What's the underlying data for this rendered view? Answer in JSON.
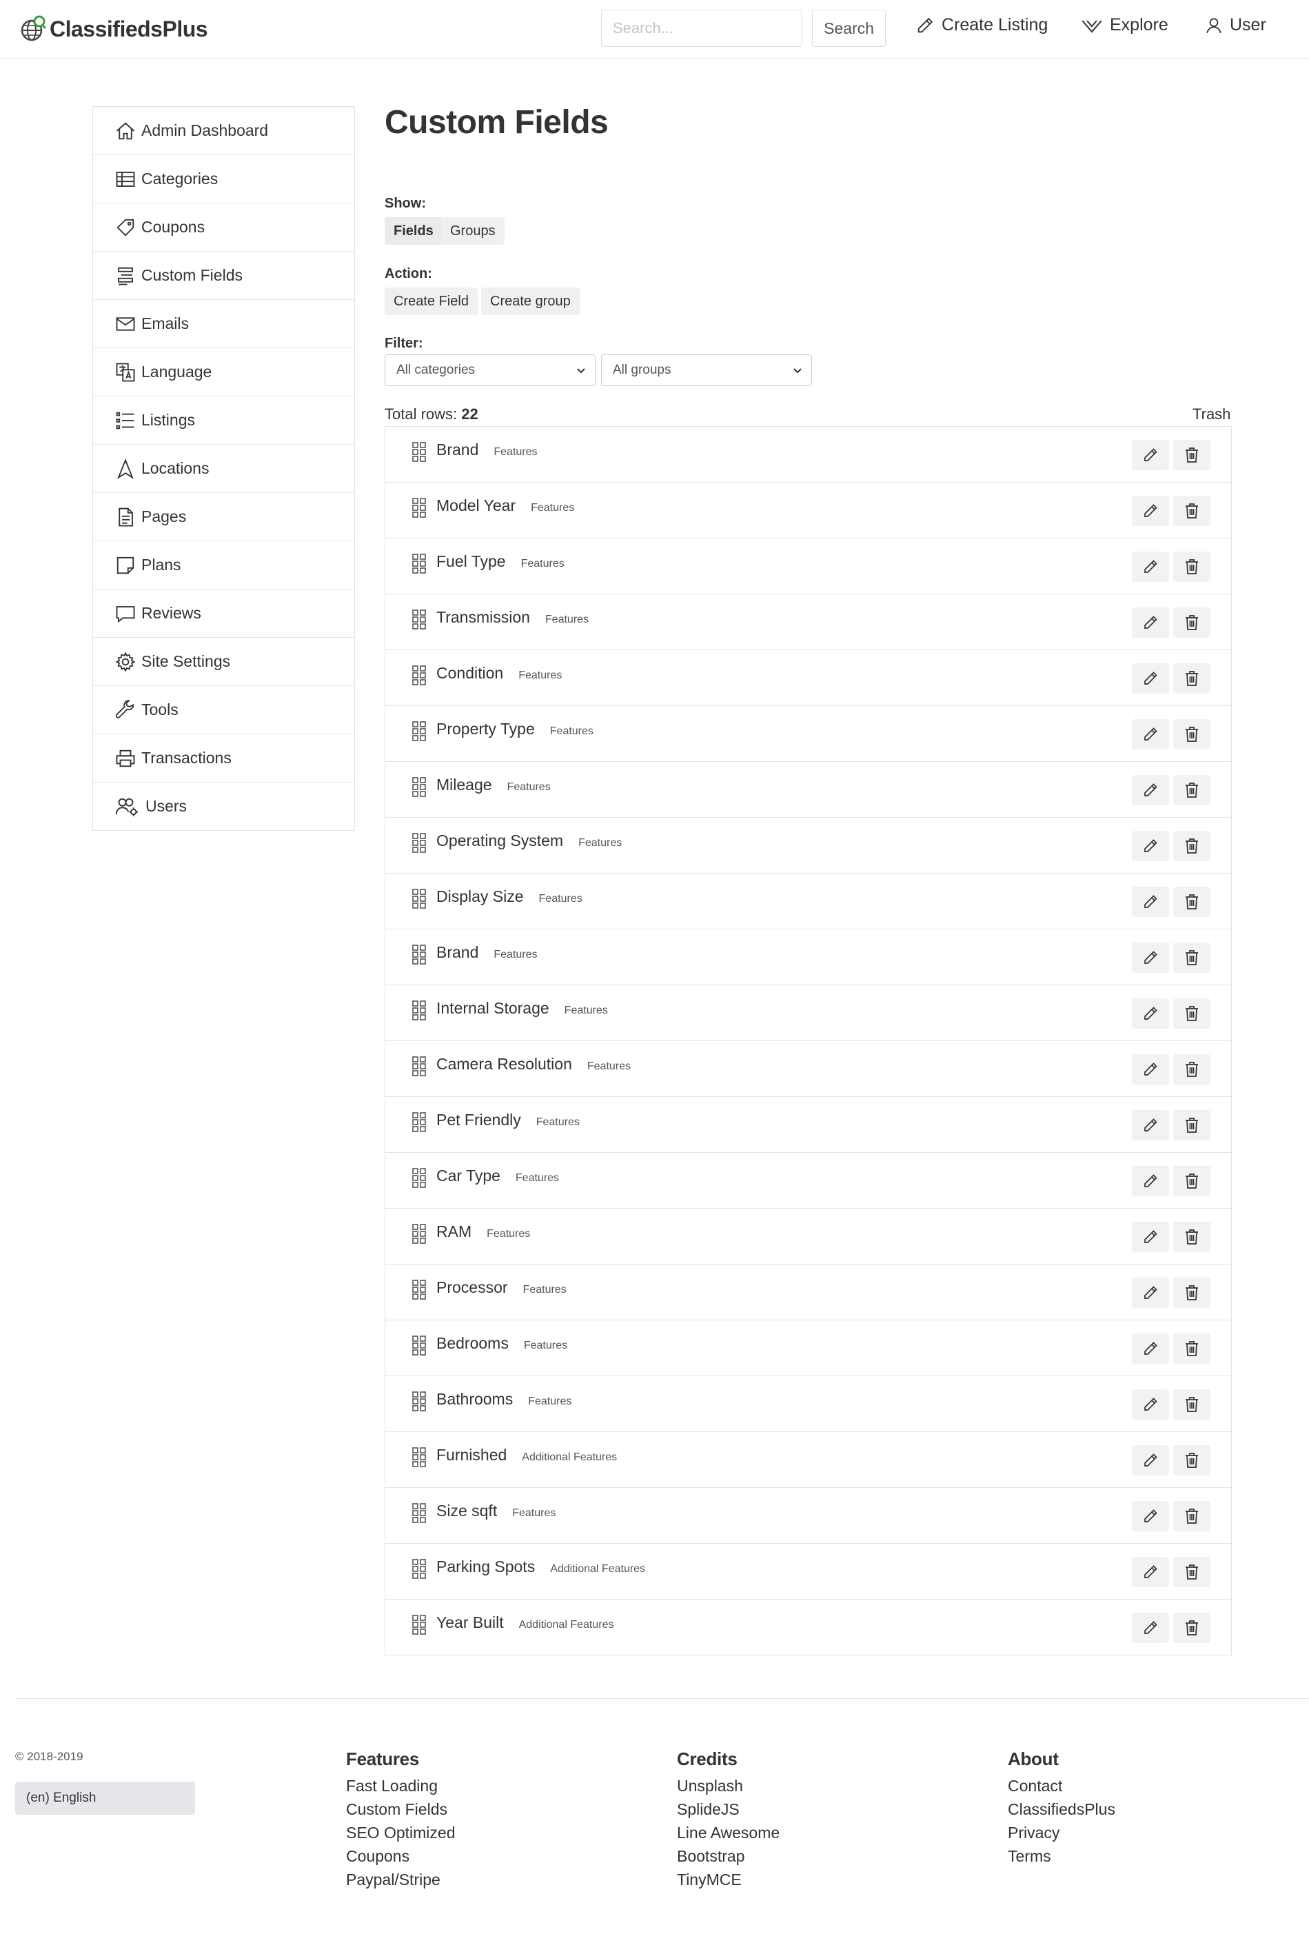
{
  "header": {
    "brand": "ClassifiedsPlus",
    "search_placeholder": "Search...",
    "search_button": "Search",
    "nav": {
      "create_listing": "Create Listing",
      "explore": "Explore",
      "user": "User"
    }
  },
  "sidebar": {
    "items": [
      {
        "label": "Admin Dashboard",
        "icon": "home-icon"
      },
      {
        "label": "Categories",
        "icon": "table-icon"
      },
      {
        "label": "Coupons",
        "icon": "tag-icon"
      },
      {
        "label": "Custom Fields",
        "icon": "fields-icon"
      },
      {
        "label": "Emails",
        "icon": "envelope-icon"
      },
      {
        "label": "Language",
        "icon": "language-icon"
      },
      {
        "label": "Listings",
        "icon": "list-icon"
      },
      {
        "label": "Locations",
        "icon": "location-arrow-icon"
      },
      {
        "label": "Pages",
        "icon": "page-icon"
      },
      {
        "label": "Plans",
        "icon": "sticky-note-icon"
      },
      {
        "label": "Reviews",
        "icon": "comment-icon"
      },
      {
        "label": "Site Settings",
        "icon": "gear-icon"
      },
      {
        "label": "Tools",
        "icon": "wrench-icon"
      },
      {
        "label": "Transactions",
        "icon": "printer-icon"
      },
      {
        "label": "Users",
        "icon": "users-icon"
      }
    ]
  },
  "main": {
    "title": "Custom Fields",
    "show_label": "Show:",
    "show_options": [
      "Fields",
      "Groups"
    ],
    "action_label": "Action:",
    "actions": [
      "Create Field",
      "Create group"
    ],
    "filter_label": "Filter:",
    "filter_category": "All categories",
    "filter_group": "All groups",
    "total_rows_label": "Total rows:",
    "total_rows": "22",
    "trash_label": "Trash",
    "fields": [
      {
        "name": "Brand",
        "group": "Features"
      },
      {
        "name": "Model Year",
        "group": "Features"
      },
      {
        "name": "Fuel Type",
        "group": "Features"
      },
      {
        "name": "Transmission",
        "group": "Features"
      },
      {
        "name": "Condition",
        "group": "Features"
      },
      {
        "name": "Property Type",
        "group": "Features"
      },
      {
        "name": "Mileage",
        "group": "Features"
      },
      {
        "name": "Operating System",
        "group": "Features"
      },
      {
        "name": "Display Size",
        "group": "Features"
      },
      {
        "name": "Brand",
        "group": "Features"
      },
      {
        "name": "Internal Storage",
        "group": "Features"
      },
      {
        "name": "Camera Resolution",
        "group": "Features"
      },
      {
        "name": "Pet Friendly",
        "group": "Features"
      },
      {
        "name": "Car Type",
        "group": "Features"
      },
      {
        "name": "RAM",
        "group": "Features"
      },
      {
        "name": "Processor",
        "group": "Features"
      },
      {
        "name": "Bedrooms",
        "group": "Features"
      },
      {
        "name": "Bathrooms",
        "group": "Features"
      },
      {
        "name": "Furnished",
        "group": "Additional Features"
      },
      {
        "name": "Size sqft",
        "group": "Features"
      },
      {
        "name": "Parking Spots",
        "group": "Additional Features"
      },
      {
        "name": "Year Built",
        "group": "Additional Features"
      }
    ]
  },
  "footer": {
    "copyright": "© 2018-2019",
    "language": "(en) English",
    "columns": [
      {
        "title": "Features",
        "links": [
          "Fast Loading",
          "Custom Fields",
          "SEO Optimized",
          "Coupons",
          "Paypal/Stripe"
        ]
      },
      {
        "title": "Credits",
        "links": [
          "Unsplash",
          "SplideJS",
          "Line Awesome",
          "Bootstrap",
          "TinyMCE"
        ]
      },
      {
        "title": "About",
        "links": [
          "Contact",
          "ClassifiedsPlus",
          "Privacy",
          "Terms"
        ]
      }
    ]
  }
}
